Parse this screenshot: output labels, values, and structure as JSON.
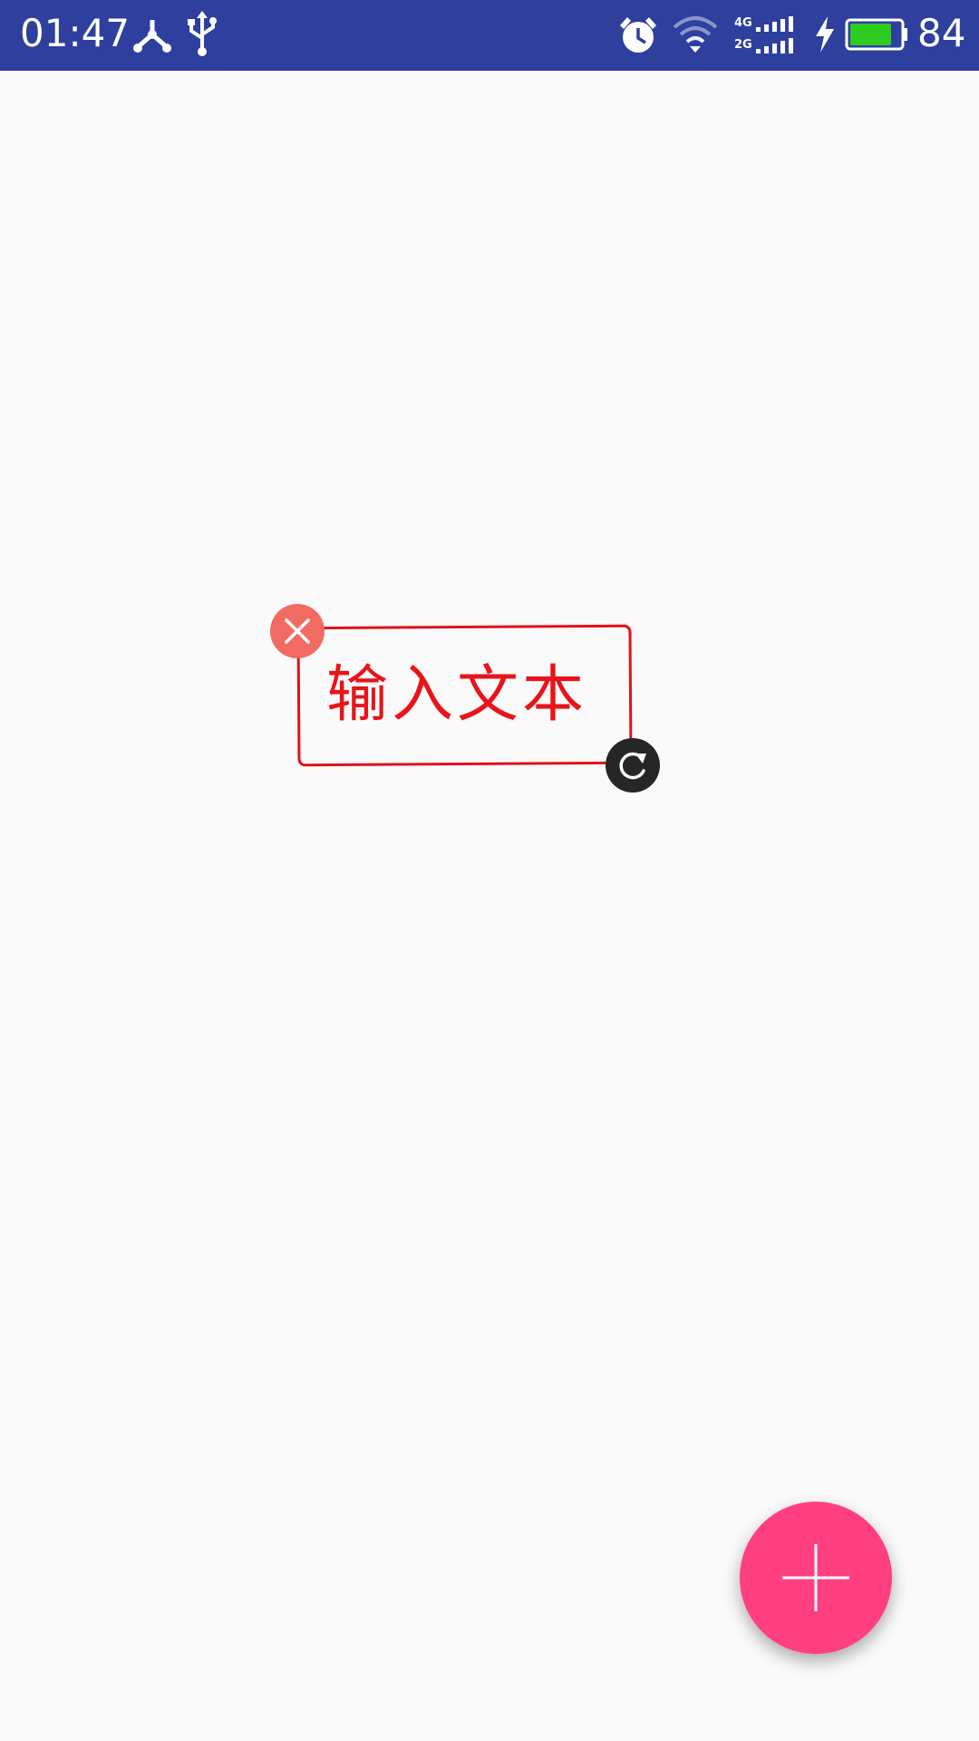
{
  "status_bar": {
    "time": "01:47",
    "battery_percent": "84",
    "network_labels": {
      "top": "4G",
      "bottom": "2G"
    },
    "icons": [
      "network-share-icon",
      "usb-icon",
      "alarm-icon",
      "wifi-icon",
      "signal-icon",
      "charging-icon",
      "battery-icon"
    ],
    "battery_level": 0.84,
    "colors": {
      "background": "#2f3f9e",
      "battery_fill": "#2ecc1f"
    }
  },
  "sticker": {
    "text": "输入文本",
    "colors": {
      "text": "#e81419",
      "border": "#e0111c"
    },
    "controls": {
      "delete_icon": "close-icon",
      "rotate_icon": "rotate-icon"
    }
  },
  "fab": {
    "icon": "plus-icon",
    "color": "#ff3f80"
  },
  "colors": {
    "page_background": "#fafafa"
  }
}
